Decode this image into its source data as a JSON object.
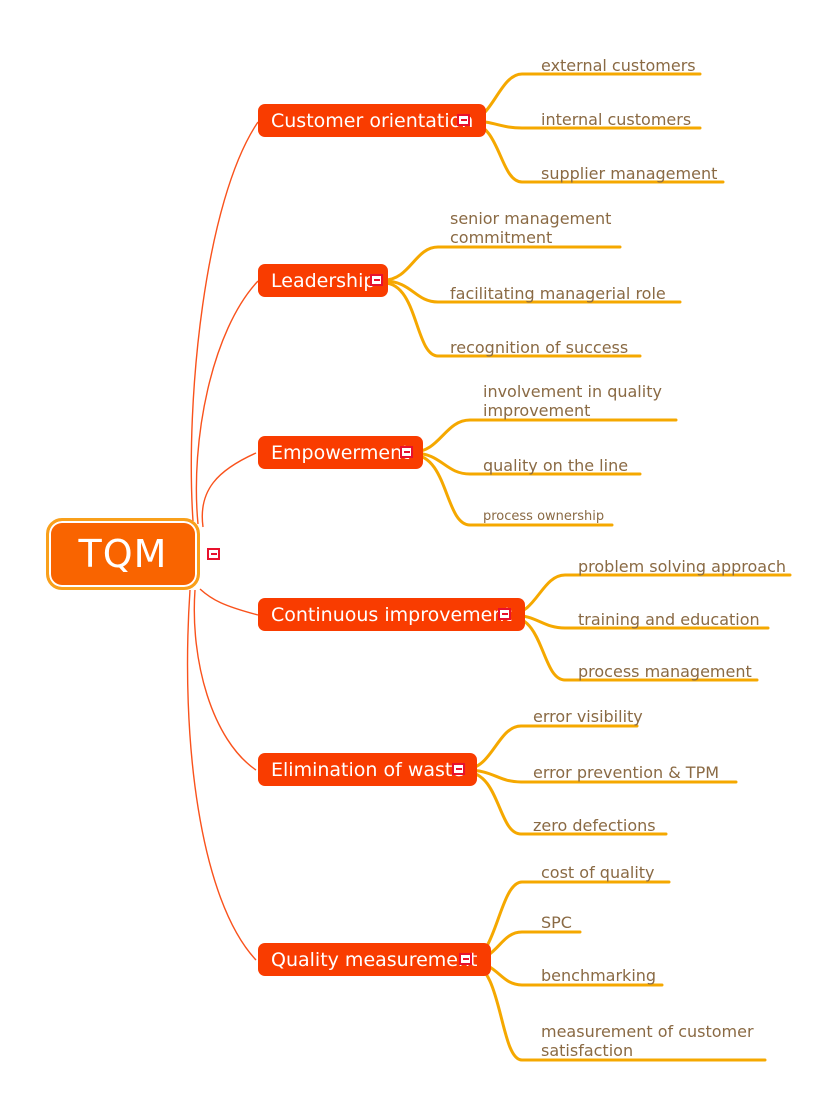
{
  "diagram": {
    "type": "mind-map",
    "title": "TQM",
    "colors": {
      "central_fill": "#F96400",
      "central_border": "#F9A01B",
      "topic_fill": "#F93C00",
      "topic_text": "#FFFFFF",
      "subtopic_text": "#8A6A44",
      "subtopic_line": "#F5A800",
      "main_branch_line": "#F9521C",
      "toggle_border": "#E8112D",
      "background": "#FFFFFF"
    },
    "central": {
      "label": "TQM",
      "toggle_icon": "collapse-minus-icon"
    },
    "branches": [
      {
        "label": "Customer orientation",
        "toggle_icon": "collapse-minus-icon",
        "children": [
          {
            "label": "external customers"
          },
          {
            "label": "internal customers"
          },
          {
            "label": "supplier management"
          }
        ]
      },
      {
        "label": "Leadership",
        "toggle_icon": "collapse-minus-icon",
        "children": [
          {
            "label": "senior management\ncommitment"
          },
          {
            "label": "facilitating managerial role"
          },
          {
            "label": "recognition of success"
          }
        ]
      },
      {
        "label": "Empowerment",
        "toggle_icon": "collapse-minus-icon",
        "children": [
          {
            "label": "involvement in quality\nimprovement"
          },
          {
            "label": "quality on the line"
          },
          {
            "label": "process ownership"
          }
        ]
      },
      {
        "label": "Continuous improvement",
        "toggle_icon": "collapse-minus-icon",
        "children": [
          {
            "label": "problem solving approach"
          },
          {
            "label": "training and education"
          },
          {
            "label": "process management"
          }
        ]
      },
      {
        "label": "Elimination of waste",
        "toggle_icon": "collapse-minus-icon",
        "children": [
          {
            "label": "error visibility"
          },
          {
            "label": "error prevention & TPM"
          },
          {
            "label": "zero defections"
          }
        ]
      },
      {
        "label": "Quality measurement",
        "toggle_icon": "collapse-minus-icon",
        "children": [
          {
            "label": "cost of quality"
          },
          {
            "label": "SPC"
          },
          {
            "label": "benchmarking"
          },
          {
            "label": "measurement of customer\nsatisfaction"
          }
        ]
      }
    ]
  }
}
